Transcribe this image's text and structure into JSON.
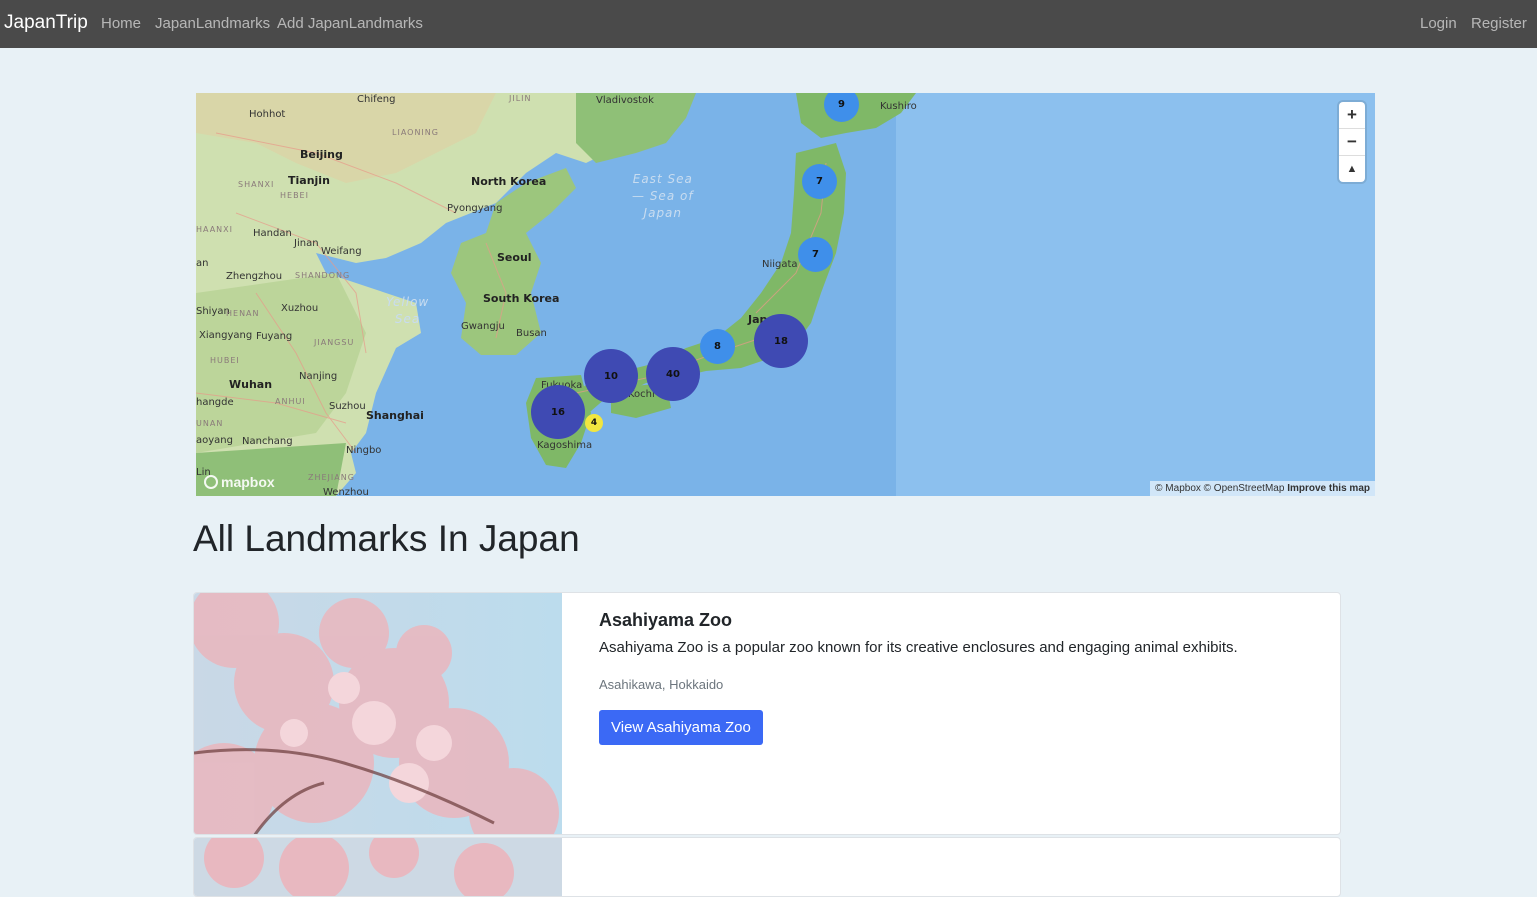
{
  "navbar": {
    "brand": "JapanTrip",
    "links": [
      "Home",
      "JapanLandmarks",
      "Add JapanLandmarks"
    ],
    "auth": [
      "Login",
      "Register"
    ]
  },
  "map": {
    "places": {
      "chifeng": "Chifeng",
      "jilin": "JILIN",
      "vladivostok": "Vladivostok",
      "hohhot": "Hohhot",
      "liaoning": "LIAONING",
      "beijing": "Beijing",
      "tianjin": "Tianjin",
      "shanxi": "SHANXI",
      "hebei": "HEBEI",
      "north_korea": "North Korea",
      "pyongyang": "Pyongyang",
      "shaanxi": "HAANXI",
      "handan": "Handan",
      "jinan": "Jinan",
      "weifang": "Weifang",
      "seoul": "Seoul",
      "zhengzhou": "Zhengzhou",
      "shandong": "SHANDONG",
      "south_korea": "South Korea",
      "shiyan": "Shiyan",
      "henan": "HENAN",
      "xuzhou": "Xuzhou",
      "gwangju": "Gwangju",
      "busan": "Busan",
      "xiangyang": "Xiangyang",
      "fuyang": "Fuyang",
      "jiangsu": "JIANGSU",
      "hubei": "HUBEI",
      "nanjing": "Nanjing",
      "wuhan": "Wuhan",
      "anhui": "ANHUI",
      "suzhou": "Suzhou",
      "shanghai": "Shanghai",
      "changde": "hangde",
      "hunan": "UNAN",
      "fukuoka": "Fukuoka",
      "kochi": "Kochi",
      "kagoshima": "Kagoshima",
      "nanchang": "Nanchang",
      "ningbo": "Ningbo",
      "zhejiang": "ZHEJIANG",
      "wenzhou": "Wenzhou",
      "shaoyang": "aoyang",
      "lin": "Lin",
      "an": "an",
      "kushiro": "Kushiro",
      "niigata": "Niigata",
      "japan": "Jap",
      "east_sea": "East Sea\n— Sea of\nJapan",
      "yellow_sea": "Yellow\nSea"
    },
    "clusters": [
      {
        "label": "9"
      },
      {
        "label": "7"
      },
      {
        "label": "7"
      },
      {
        "label": "18"
      },
      {
        "label": "8"
      },
      {
        "label": "40"
      },
      {
        "label": "10"
      },
      {
        "label": "16"
      },
      {
        "label": "4"
      }
    ],
    "zoom_in": "+",
    "zoom_out": "−",
    "compass": "▲",
    "logo": "mapbox",
    "attribution": "© Mapbox © OpenStreetMap",
    "improve": "Improve this map"
  },
  "page_title": "All Landmarks In Japan",
  "landmarks": [
    {
      "name": "Asahiyama Zoo",
      "description": "Asahiyama Zoo is a popular zoo known for its creative enclosures and engaging animal exhibits.",
      "location": "Asahikawa, Hokkaido",
      "button": "View Asahiyama Zoo"
    }
  ]
}
